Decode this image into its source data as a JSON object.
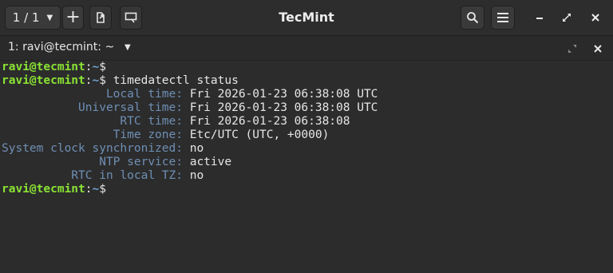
{
  "header": {
    "tab_counter": "1 / 1",
    "title": "TecMint"
  },
  "tab": {
    "label": "1: ravi@tecmint: ~"
  },
  "terminal": {
    "prompt_user": "ravi@tecmint",
    "prompt_colon": ":",
    "prompt_path": "~",
    "prompt_dollar": "$",
    "command": " timedatectl status",
    "fields": [
      {
        "label": "               Local time:",
        "value": " Fri 2026-01-23 06:38:08 UTC"
      },
      {
        "label": "           Universal time:",
        "value": " Fri 2026-01-23 06:38:08 UTC"
      },
      {
        "label": "                 RTC time:",
        "value": " Fri 2026-01-23 06:38:08"
      },
      {
        "label": "                Time zone:",
        "value": " Etc/UTC (UTC, +0000)"
      },
      {
        "label": "System clock synchronized:",
        "value": " no"
      },
      {
        "label": "              NTP service:",
        "value": " active"
      },
      {
        "label": "          RTC in local TZ:",
        "value": " no"
      }
    ]
  },
  "colors": {
    "prompt_user": "#8ae234",
    "prompt_path": "#729fcf",
    "field_label": "#6f8fb5",
    "text": "#e6e6e6",
    "background": "#2c2c2c"
  },
  "icons": {
    "new_tab": "plus-icon",
    "detach_tab": "detach-tab-icon",
    "read_only": "read-only-icon",
    "search": "search-icon",
    "menu": "hamburger-menu-icon",
    "minimize": "minimize-icon",
    "maximize": "maximize-icon",
    "close": "close-icon"
  }
}
